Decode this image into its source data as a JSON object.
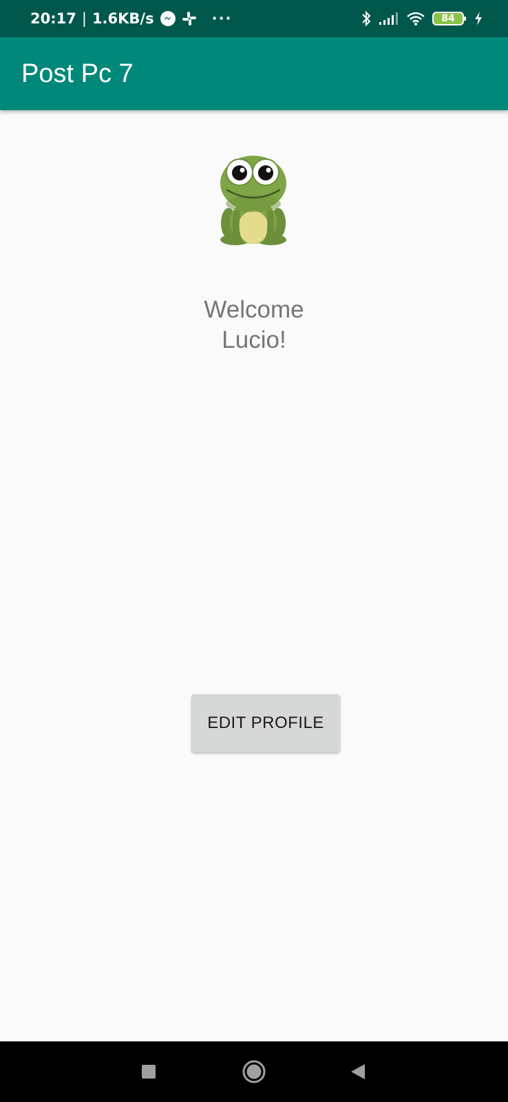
{
  "status_bar": {
    "time": "20:17",
    "separator": "|",
    "net_speed": "1.6KB/s",
    "more": "···",
    "battery_level": "84",
    "icons": [
      "messenger-icon",
      "slack-icon",
      "bluetooth-icon",
      "signal-icon",
      "wifi-icon",
      "battery-icon",
      "charging-icon"
    ]
  },
  "app_bar": {
    "title": "Post Pc 7",
    "color": "#00897b"
  },
  "main": {
    "avatar_icon": "frog-icon",
    "welcome_text": "Welcome\nLucio!",
    "edit_button_label": "EDIT PROFILE"
  },
  "nav_bar": {
    "icons": [
      "recents-square-icon",
      "home-circle-icon",
      "back-triangle-icon"
    ]
  },
  "colors": {
    "status_bar": "#00574b",
    "accent": "#00897b",
    "background": "#fafafa",
    "button": "#d6d7d7"
  }
}
